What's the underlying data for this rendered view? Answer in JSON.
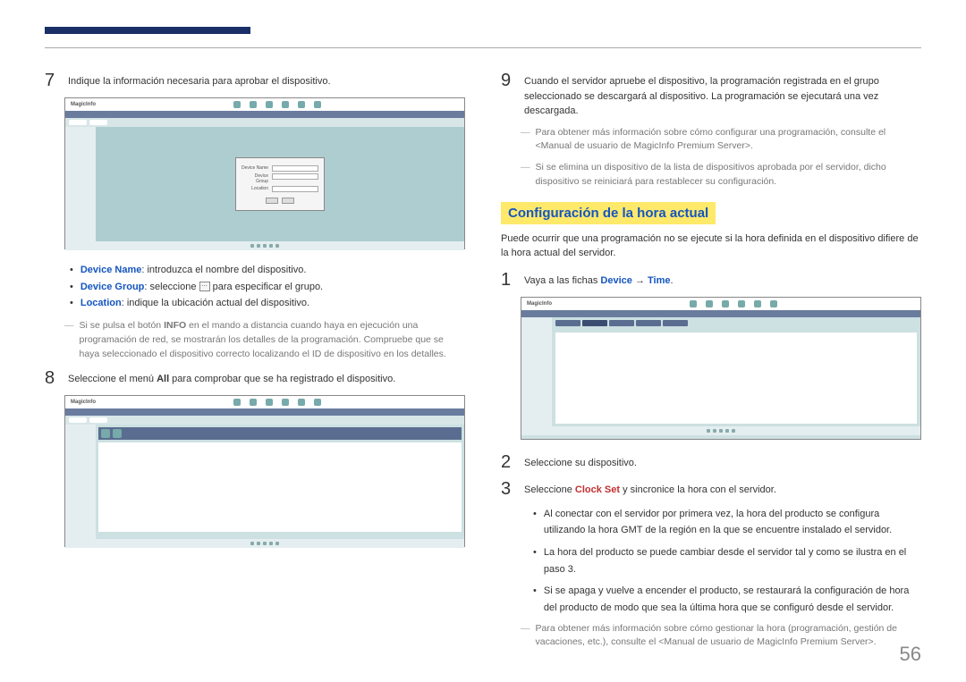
{
  "step7": {
    "num": "7",
    "text": "Indique la información necesaria para aprobar el dispositivo."
  },
  "screenshot1_brand": "MagicInfo",
  "bullets1": {
    "b1_label": "Device Name",
    "b1_text": ": introduzca el nombre del dispositivo.",
    "b2_label": "Device Group",
    "b2_text_a": ": seleccione ",
    "b2_text_b": " para especificar el grupo.",
    "b3_label": "Location",
    "b3_text": ": indique la ubicación actual del dispositivo."
  },
  "note1_a": "Si se pulsa el botón ",
  "note1_info": "INFO",
  "note1_b": " en el mando a distancia cuando haya en ejecución una programación de red, se mostrarán los detalles de la programación. Compruebe que se haya seleccionado el dispositivo correcto localizando el ID de dispositivo en los detalles.",
  "step8": {
    "num": "8",
    "text_a": "Seleccione el menú ",
    "text_all": "All",
    "text_b": " para comprobar que se ha registrado el dispositivo."
  },
  "step9": {
    "num": "9",
    "text": "Cuando el servidor apruebe el dispositivo, la programación registrada en el grupo seleccionado se descargará al dispositivo. La programación se ejecutará una vez descargada."
  },
  "note2": "Para obtener más información sobre cómo configurar una programación, consulte el <Manual de usuario de MagicInfo Premium Server>.",
  "note3": "Si se elimina un dispositivo de la lista de dispositivos aprobada por el servidor, dicho dispositivo se reiniciará para restablecer su configuración.",
  "section_heading": "Configuración de la hora actual",
  "section_intro": "Puede ocurrir que una programación no se ejecute si la hora definida en el dispositivo difiere de la hora actual del servidor.",
  "step_r1": {
    "num": "1",
    "text_a": "Vaya a las fichas ",
    "text_device": "Device",
    "text_arrow": " → ",
    "text_time": "Time",
    "text_dot": "."
  },
  "step_r2": {
    "num": "2",
    "text": "Seleccione su dispositivo."
  },
  "step_r3": {
    "num": "3",
    "text_a": "Seleccione ",
    "text_label": "Clock Set",
    "text_b": " y sincronice la hora con el servidor."
  },
  "sub_bullets": {
    "s1": "Al conectar con el servidor por primera vez, la hora del producto se configura utilizando la hora GMT de la región en la que se encuentre instalado el servidor.",
    "s2": "La hora del producto se puede cambiar desde el servidor tal y como se ilustra en el paso 3.",
    "s3": "Si se apaga y vuelve a encender el producto, se restaurará la configuración de hora del producto de modo que sea la última hora que se configuró desde el servidor."
  },
  "note4": "Para obtener más información sobre cómo gestionar la hora (programación, gestión de vacaciones, etc.), consulte el <Manual de usuario de MagicInfo Premium Server>.",
  "page_number": "56"
}
